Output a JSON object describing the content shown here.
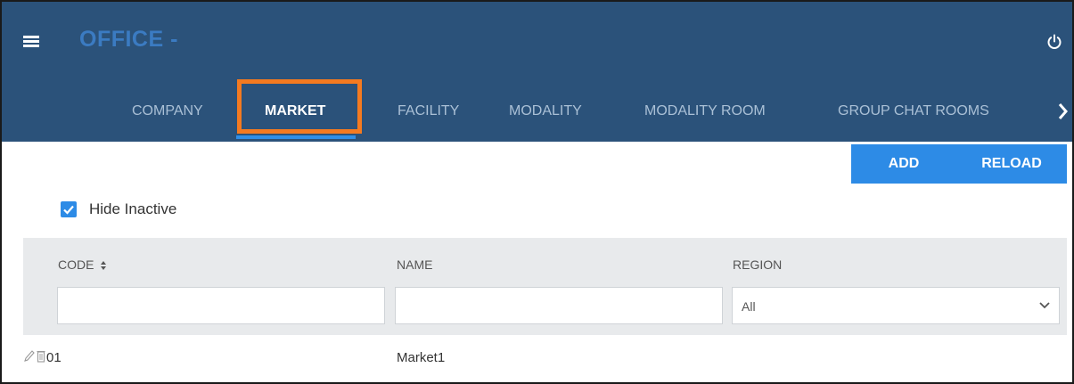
{
  "app": {
    "title": "OFFICE -"
  },
  "tabs": [
    {
      "label": "COMPANY",
      "active": false
    },
    {
      "label": "MARKET",
      "active": true
    },
    {
      "label": "FACILITY",
      "active": false
    },
    {
      "label": "MODALITY",
      "active": false
    },
    {
      "label": "MODALITY ROOM",
      "active": false
    },
    {
      "label": "GROUP CHAT ROOMS",
      "active": false
    }
  ],
  "icons": {
    "menu": "hamburger-icon",
    "power": "power-icon",
    "next": "chevron-right-icon",
    "edit": "pencil-icon",
    "delete": "trash-icon",
    "sort": "sort-icon",
    "dropdown": "chevron-down-icon",
    "check": "checkmark-icon"
  },
  "actions": {
    "add": "ADD",
    "reload": "RELOAD"
  },
  "filter": {
    "hide_inactive_label": "Hide Inactive",
    "hide_inactive_checked": true
  },
  "grid": {
    "columns": [
      {
        "key": "code",
        "label": "CODE"
      },
      {
        "key": "name",
        "label": "NAME"
      },
      {
        "key": "region",
        "label": "REGION"
      }
    ],
    "filters": {
      "code": "",
      "name": "",
      "region": "All"
    },
    "rows": [
      {
        "code": "01",
        "name": "Market1",
        "region": ""
      }
    ]
  },
  "colors": {
    "header_bg": "#2b527a",
    "accent": "#2d8be6",
    "highlight": "#f47a20",
    "title": "#3b7bc2"
  }
}
